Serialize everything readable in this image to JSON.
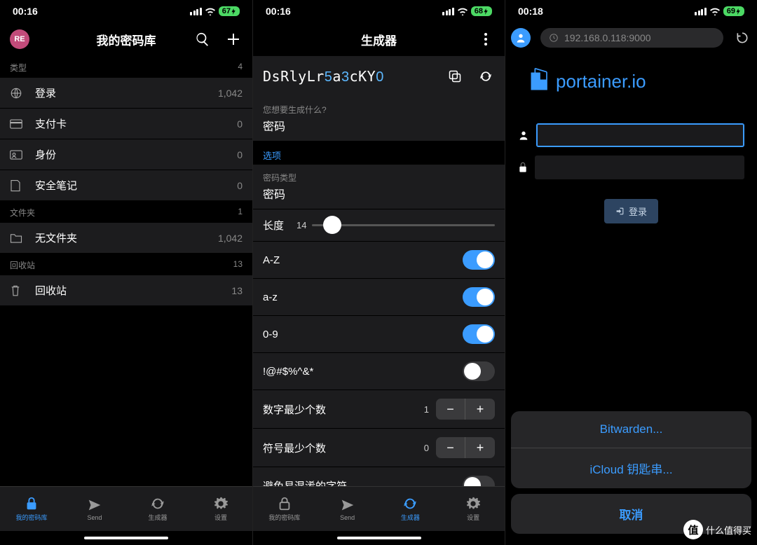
{
  "watermark": "什么值得买",
  "watermark_badge": "值",
  "phone1": {
    "time": "00:16",
    "battery": "67",
    "avatar": "RE",
    "title": "我的密码库",
    "sections": {
      "types": {
        "header": "类型",
        "count": "4",
        "items": [
          {
            "label": "登录",
            "value": "1,042"
          },
          {
            "label": "支付卡",
            "value": "0"
          },
          {
            "label": "身份",
            "value": "0"
          },
          {
            "label": "安全笔记",
            "value": "0"
          }
        ]
      },
      "folders": {
        "header": "文件夹",
        "count": "1",
        "items": [
          {
            "label": "无文件夹",
            "value": "1,042"
          }
        ]
      },
      "trash": {
        "header": "回收站",
        "count": "13",
        "items": [
          {
            "label": "回收站",
            "value": "13"
          }
        ]
      }
    },
    "tabs": [
      "我的密码库",
      "Send",
      "生成器",
      "设置"
    ]
  },
  "phone2": {
    "time": "00:16",
    "battery": "68",
    "title": "生成器",
    "password_plain": "DsRlyLr5a3cKY0",
    "what_label": "您想要生成什么?",
    "what_value": "密码",
    "options_header": "选项",
    "type_label": "密码类型",
    "type_value": "密码",
    "length_label": "长度",
    "length_value": "14",
    "toggles": [
      {
        "label": "A-Z",
        "on": true
      },
      {
        "label": "a-z",
        "on": true
      },
      {
        "label": "0-9",
        "on": true
      },
      {
        "label": "!@#$%^&*",
        "on": false
      }
    ],
    "min_digits": {
      "label": "数字最少个数",
      "value": "1"
    },
    "min_symbols": {
      "label": "符号最少个数",
      "value": "0"
    },
    "avoid_label": "避免易混淆的字符",
    "tabs": [
      "我的密码库",
      "Send",
      "生成器",
      "设置"
    ]
  },
  "phone3": {
    "time": "00:18",
    "battery": "69",
    "url": "192.168.0.118:9000",
    "logo_text": "portainer.io",
    "login_btn": "登录",
    "sheet": {
      "options": [
        "Bitwarden...",
        "iCloud 钥匙串..."
      ],
      "cancel": "取消"
    }
  }
}
